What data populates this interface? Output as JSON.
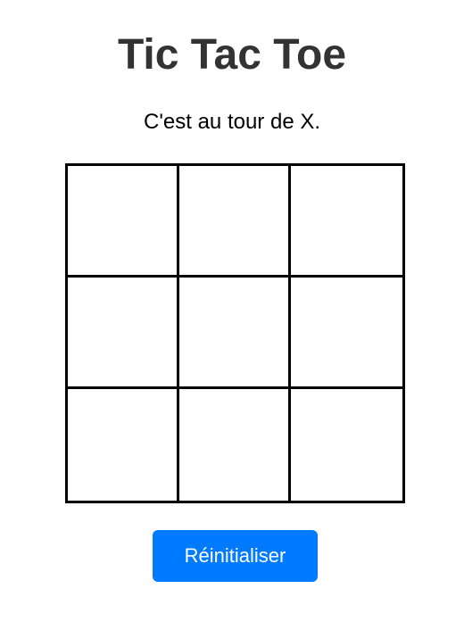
{
  "title": "Tic Tac Toe",
  "status": "C'est au tour de X.",
  "current_player": "X",
  "board": {
    "cells": [
      "",
      "",
      "",
      "",
      "",
      "",
      "",
      "",
      ""
    ]
  },
  "reset_button": {
    "label": "Réinitialiser"
  },
  "colors": {
    "accent": "#007bff",
    "title": "#333333",
    "grid": "#000000",
    "background": "#ffffff"
  }
}
